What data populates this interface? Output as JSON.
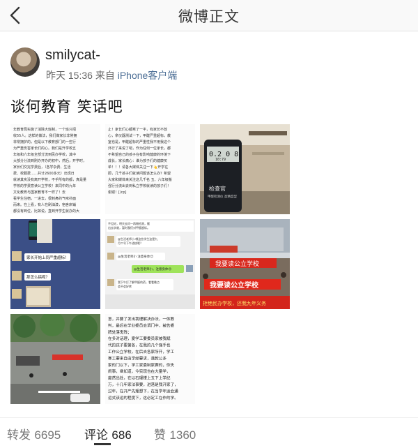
{
  "nav": {
    "title": "微博正文"
  },
  "author": {
    "username": "smilycat-",
    "time": "昨天 15:36",
    "source_prefix": "来自",
    "source": "iPhone客户端"
  },
  "post": {
    "text": "谈何教育 笑话吧"
  },
  "images": [
    {
      "kind": "text-screenshot",
      "lines": [
        "年教育局实施了消除大班制，一个班只招",
        "收55人。这样的做法，我们做家长非常拥",
        "非常拥护的，但是以下教育部门的一些行",
        "为严重伤害家长们的心。我们是升学校五",
        "年级和六年级全部分流到民办学校，其中",
        "大部分分流到刚办开办的初中，然后，开学时，",
        "家长们交完学费后，（各学杂费、生活",
        "费、校服费……共计2600多元）出现日",
        "就读其实没有离开学校，不乎所有的都，真是量",
        "学校的学费意读公立学校！来同中的九年",
        "文化教育与国家教育不一样了！去",
        "看学生住宿，一进去，很刺鼻的气味扑面",
        "而来。在上看，有人在刷油漆，宿舍床铺",
        "都没有到位，比如说，直到开学生就办的大"
      ]
    },
    {
      "kind": "text-screenshot",
      "lines": [
        "止！家长们心都寒了一半，有家长不放",
        "心，拿仪器测试一下，甲醛严重超标，教",
        "室也是，甲醛超标的严重性我不用我这个",
        "外行了来说了吧，作为任何一位家长，都",
        "不希望自己的孩子在有影响健康的环境下",
        "成长，家长痛心：谁为孩子们的健康买",
        "单！！！请各大媒体关注一下👆开学在",
        "即，几千孩子们就读问题该怎么办？希望",
        "大家和媒体来关注这几千名 五、六年级搬",
        "强行分流出去到私立学校就读的孩子们！",
        "谢谢！[/cp]"
      ]
    },
    {
      "kind": "photo",
      "caption": "检查官",
      "subcaption": "甲醛检测仪 高精度型",
      "readings": [
        "0.2 0 8",
        "10:79"
      ]
    },
    {
      "kind": "chat",
      "messages": [
        "家长开始上同严重超标！",
        "那怎么搞呢？"
      ]
    },
    {
      "kind": "chat-light",
      "messages": [
        "不见好，明天去问一再物检测，搬出去学就，暂时我们对甲醛超标。",
        "@生活老师小.哪这些学生这是九月二号下午进校呢？",
        "@生活老师小 注意身体😊",
        "@生活老师小。注意身体😊",
        "我下午打了解甲醛的药，看看晚点会不会好转"
      ]
    },
    {
      "kind": "photo-protest",
      "banner1": "我要读公立学校",
      "banner2": "我要读公立学校",
      "banner3": "拒绝民办学校，还我九年义务"
    },
    {
      "kind": "photo-street"
    },
    {
      "kind": "handwriting",
      "lines": [
        "意，并要了发出我理解决办法，一体教",
        "判，最后在学业委员会调门中，被告委",
        "牌处落鬼残；",
        "在多对话理，夏学工要委员家被我赋",
        "代的孩子要第各，在我的几个强手也",
        "工作公立学校，在后去各家所开，学工",
        "寒工要来自由学经要求，落款公多",
        "家的门以下，学工家委制家赛的，你失",
        "闹事，继如道，今实现也在大量学，",
        "度然出处，在以石理楼上五下上学纪",
        "万，十几年家法事要，进落是我开家了，",
        "过年，在开产先理想下，在当学年运会通",
        "运式该运的程度下，这必定工在作的学。"
      ]
    },
    {
      "kind": "blank"
    }
  ],
  "tabs": [
    {
      "label": "转发",
      "count": "6695"
    },
    {
      "label": "评论",
      "count": "686"
    },
    {
      "label": "赞",
      "count": "1360"
    }
  ]
}
